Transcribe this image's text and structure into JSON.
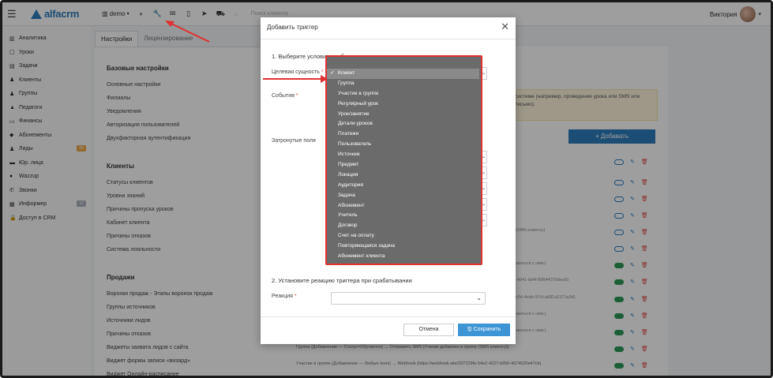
{
  "colors": {
    "brand": "#2e7dbd",
    "accent_red": "#e03131",
    "save_button": "#3d95d6"
  },
  "topbar": {
    "logo_text": "alfacrm",
    "branch_label": "demo",
    "search_placeholder": "Поиск клиента",
    "user_name": "Виктория",
    "icons": [
      "plus-icon",
      "wrench-icon",
      "mail-icon",
      "mobile-icon",
      "telegram-icon",
      "cart-icon",
      "bell-icon"
    ]
  },
  "sidebar": {
    "items": [
      {
        "label": "Аналитика",
        "icon": "bar-chart-icon"
      },
      {
        "label": "Уроки",
        "icon": "calendar-icon"
      },
      {
        "label": "Задачи",
        "icon": "tasks-icon"
      },
      {
        "label": "Клиенты",
        "icon": "user-icon"
      },
      {
        "label": "Группы",
        "icon": "users-icon"
      },
      {
        "label": "Педагоги",
        "icon": "graduation-cap-icon"
      },
      {
        "label": "Финансы",
        "icon": "money-icon"
      },
      {
        "label": "Абонементы",
        "icon": "tag-icon"
      },
      {
        "label": "Лиды",
        "icon": "user-plus-icon",
        "badge": "55"
      },
      {
        "label": "Юр. лица",
        "icon": "briefcase-icon"
      },
      {
        "label": "Wazzup",
        "icon": "chat-icon"
      },
      {
        "label": "Звонки",
        "icon": "phone-icon"
      },
      {
        "label": "Информер",
        "icon": "info-board-icon",
        "badge": "17"
      },
      {
        "label": "Доступ в CRM",
        "icon": "lock-icon"
      }
    ]
  },
  "tabs": [
    "Настройки",
    "Лицензирование"
  ],
  "settings": {
    "base_heading": "Базовые настройки",
    "base_items": [
      "Основные настройки",
      "Филиалы",
      "Уведомления",
      "Авторизация пользователей",
      "Двухфакторная аутентификация"
    ],
    "clients_heading": "Клиенты",
    "clients_items": [
      "Статусы клиентов",
      "Уровни знаний",
      "Причины пропуска уроков",
      "Кабинет клиента",
      "Причины отказов",
      "Система лояльности"
    ],
    "sales_heading": "Продажи",
    "sales_items": [
      "Воронки продаж - Этапы воронок продаж",
      "Группы источников",
      "Источники лидов",
      "Причины отказов",
      "Виджеты захвата лидов с сайта",
      "Виджет формы записи «визард»",
      "Виджет Онлайн-расписание"
    ]
  },
  "background": {
    "notice_text": "системе (например, проведение урока или SMS или письмо).",
    "add_button": "+ Добавать",
    "rows_right": [
      "",
      "",
      "",
      "",
      "",
      "(SMS клиенту)",
      "",
      "зваться с ним.)",
      "-4941-bb4f-89644370dea9)",
      "c54-4eeb-97cf-a681a1371a3d)",
      "зваться с ним.)",
      "зваться с ним.)"
    ],
    "row_full_1": "Группа (Добавление — Статус=Обучается) → Отправить SMS (Ученик добавлен в группу (SMS клиенту))",
    "row_full_2": "Участие в группе (Добавление — Любые поля) → Webhook (https://webhook.site/337229fe-54e2-4227-b950-4074520e47cb)"
  },
  "modal": {
    "title": "Добавить триггер",
    "step1": "1. Выберите условие срабатывания триггера",
    "target_label": "Целевая сущность",
    "events_label": "События",
    "fields_label": "Затронутые поля",
    "step2": "2. Установите реакцию триггера при срабатывании",
    "reaction_label": "Реакция",
    "reaction_value": "",
    "cancel": "Отмена",
    "save": "Сохранить",
    "required_mark": "*"
  },
  "dropdown": {
    "selected": "Клиент",
    "options": [
      "Клиент",
      "Группа",
      "Участие в группе",
      "Регулярный урок",
      "Урок/занятие",
      "Детали уроков",
      "Платежи",
      "Пользователь",
      "Источник",
      "Предмет",
      "Локация",
      "Аудитория",
      "Задача",
      "Абонемент",
      "Учитель",
      "Договор",
      "Счет на оплату",
      "Повторяющаяся задача",
      "Абонемент клиента"
    ]
  }
}
